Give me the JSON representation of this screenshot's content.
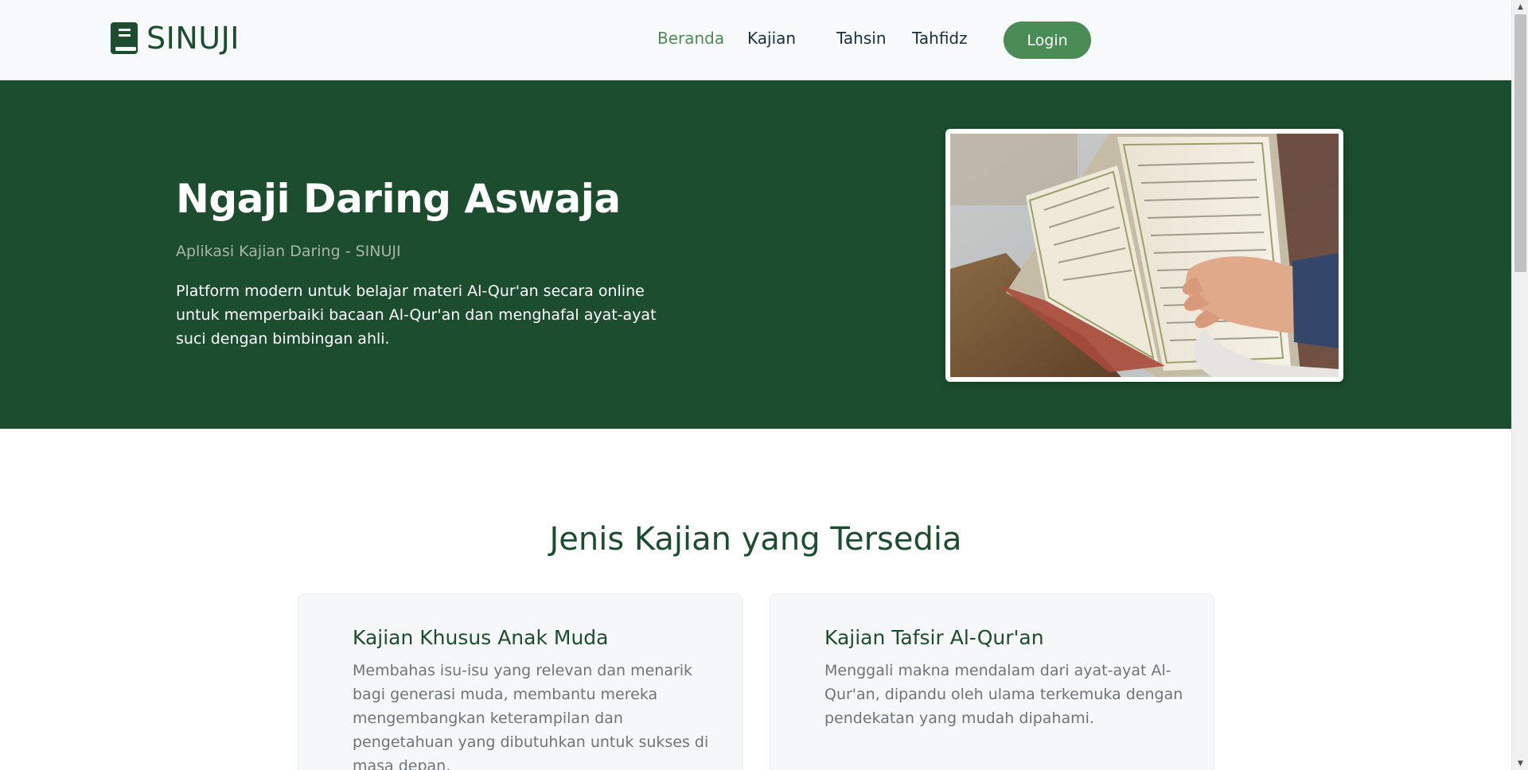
{
  "navbar": {
    "brand": "SINUJI",
    "brand_icon": "book-icon",
    "links": [
      {
        "label": "Beranda",
        "active": true
      },
      {
        "label": "Kajian",
        "active": false
      },
      {
        "label": "Tahsin",
        "active": false
      },
      {
        "label": "Tahfidz",
        "active": false
      }
    ],
    "login_label": "Login"
  },
  "hero": {
    "title": "Ngaji Daring Aswaja",
    "subtitle": "Aplikasi Kajian Daring - SINUJI",
    "description": "Platform modern untuk belajar materi Al-Qur'an secara online untuk memperbaiki bacaan Al-Qur'an dan menghafal ayat-ayat suci dengan bimbingan ahli."
  },
  "section": {
    "title": "Jenis Kajian yang Tersedia",
    "cards": [
      {
        "title": "Kajian Khusus Anak Muda",
        "description": "Membahas isu-isu yang relevan dan menarik bagi generasi muda, membantu mereka mengembangkan keterampilan dan pengetahuan yang dibutuhkan untuk sukses di masa depan."
      },
      {
        "title": "Kajian Tafsir Al-Qur'an",
        "description": "Menggali makna mendalam dari ayat-ayat Al-Qur'an, dipandu oleh ulama terkemuka dengan pendekatan yang mudah dipahami."
      }
    ]
  },
  "colors": {
    "primary": "#1b4d2e",
    "accent": "#4a8c56",
    "nav_bg": "#f8f9fa",
    "card_bg": "#f6f7f8"
  }
}
